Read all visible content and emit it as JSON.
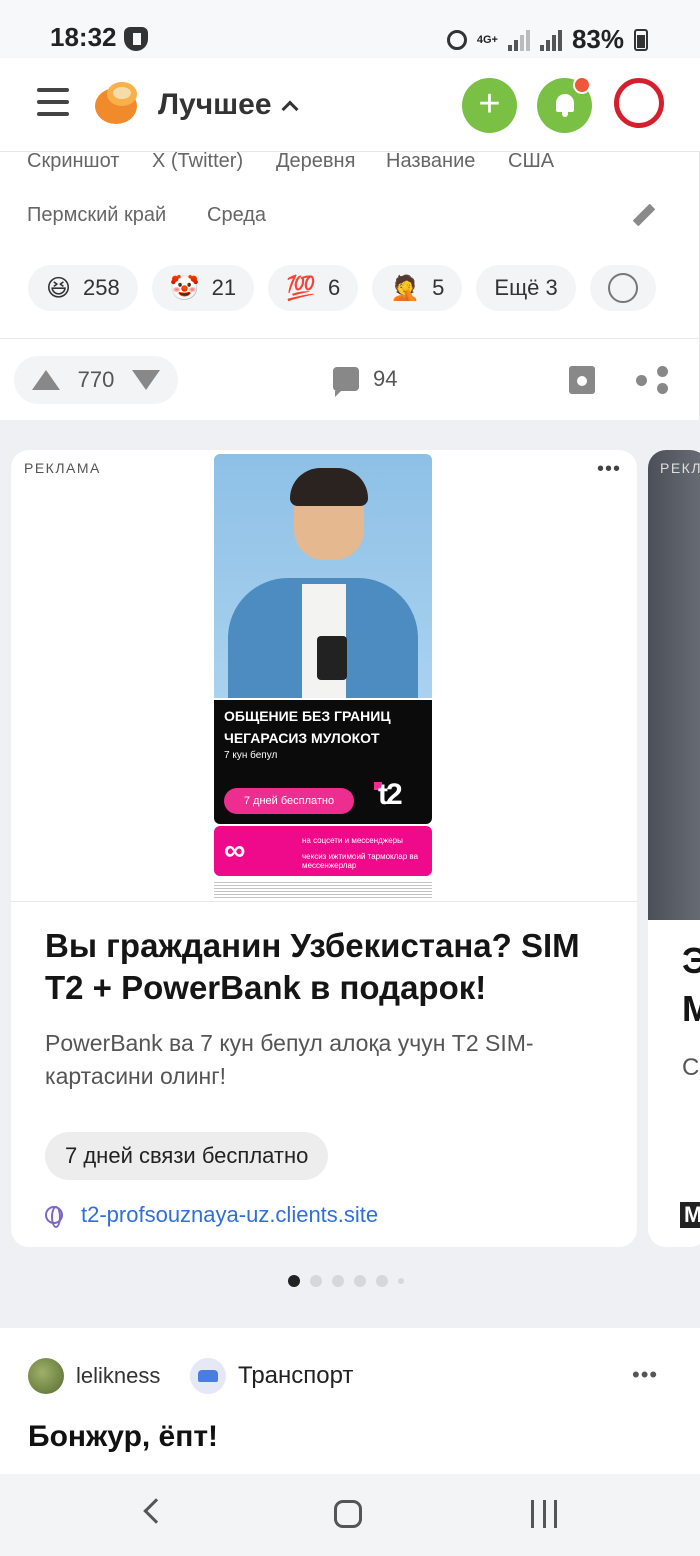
{
  "status_bar": {
    "time": "18:32",
    "network": "4G+",
    "battery": "83%"
  },
  "header": {
    "feed_title": "Лучшее"
  },
  "post": {
    "tags_row1": [
      "Скриншот",
      "X (Twitter)",
      "Деревня",
      "Название",
      "США"
    ],
    "tags_row2": [
      "Пермский край",
      "Среда"
    ],
    "reactions": [
      {
        "emoji": "😆",
        "count": "258"
      },
      {
        "emoji": "🤡",
        "count": "21"
      },
      {
        "emoji": "💯",
        "count": "6"
      },
      {
        "emoji": "🤦",
        "count": "5"
      }
    ],
    "more_reactions": "Ещё 3",
    "rating": "770",
    "comments": "94"
  },
  "ad": {
    "label": "РЕКЛАМА",
    "creative": {
      "line1": "ОБЩЕНИЕ БЕЗ ГРАНИЦ",
      "line2": "ЧЕГАРАСИЗ МУЛОКОТ",
      "line3": "7 кун бепул",
      "button": "7 дней бесплатно",
      "brand": "t2",
      "infinity": "∞",
      "pink1": "на соцсети и мессенджеры",
      "pink2": "чексиз ижтимоий тармоклар ва мессенжерлар"
    },
    "title": "Вы гражданин Узбекистана? SIM T2 + PowerBank в подарок!",
    "description": "PowerBank ва 7 кун бепул алоқа учун T2 SIM-картасини олинг!",
    "cta": "7 дней связи бесплатно",
    "link": "t2-profsouznaya-uz.clients.site"
  },
  "ad_next": {
    "label": "РЕКЛА",
    "t1": "Э",
    "t2": "М",
    "t3": "С",
    "t4": "M"
  },
  "post2": {
    "author": "lelikness",
    "category": "Транспорт",
    "title": "Бонжур, ёпт!"
  }
}
